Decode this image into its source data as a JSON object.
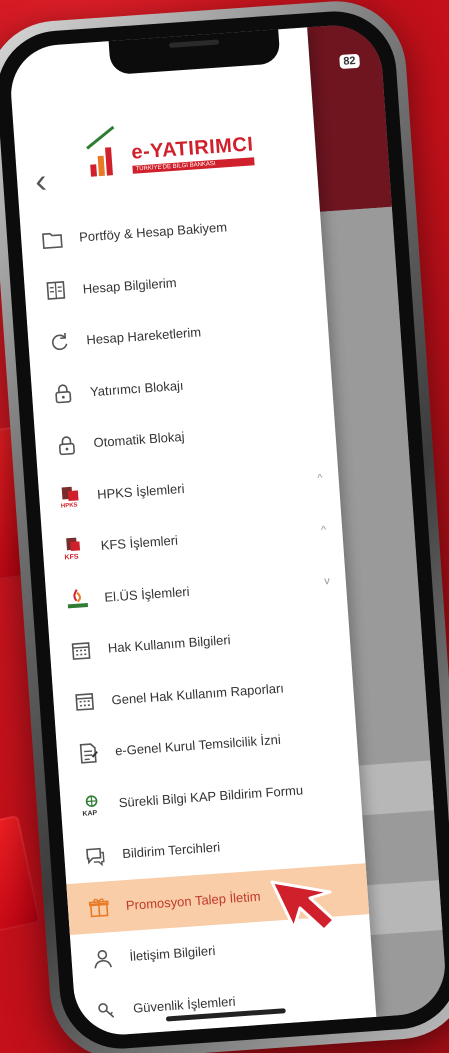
{
  "app": {
    "logo_title": "e-YATIRIMCI",
    "logo_subtitle": "TÜRKİYE'DE BİLGİ BANKASI",
    "back_label": "‹",
    "status_battery": "82"
  },
  "colors": {
    "brand_red": "#d0202b",
    "active_bg": "#f8cda7",
    "active_text": "#c0392b"
  },
  "menu": [
    {
      "label": "Portföy & Hesap Bakiyem",
      "icon": "folder-icon"
    },
    {
      "label": "Hesap Bilgilerim",
      "icon": "ledger-icon"
    },
    {
      "label": "Hesap Hareketlerim",
      "icon": "refresh-icon"
    },
    {
      "label": "Yatırımcı Blokajı",
      "icon": "lock-icon"
    },
    {
      "label": "Otomatik Blokaj",
      "icon": "lock-icon"
    },
    {
      "label": "HPKS İşlemleri",
      "icon": "hpks-icon",
      "chevron": "^"
    },
    {
      "label": "KFS İşlemleri",
      "icon": "kfs-icon",
      "chevron": "^"
    },
    {
      "label": "El.ÜS İşlemleri",
      "icon": "elus-icon",
      "chevron": "v"
    },
    {
      "label": "Hak Kullanım Bilgileri",
      "icon": "calendar-icon"
    },
    {
      "label": "Genel Hak Kullanım Raporları",
      "icon": "calendar-icon"
    },
    {
      "label": "e-Genel Kurul Temsilcilik İzni",
      "icon": "document-icon"
    },
    {
      "label": "Sürekli Bilgi KAP Bildirim Formu",
      "icon": "kap-icon"
    },
    {
      "label": "Bildirim Tercihleri",
      "icon": "chat-icon"
    },
    {
      "label": "Promosyon Talep İletim",
      "icon": "gift-icon",
      "active": true
    },
    {
      "label": "İletişim Bilgileri",
      "icon": "person-icon"
    },
    {
      "label": "Güvenlik İşlemleri",
      "icon": "key-icon"
    }
  ]
}
